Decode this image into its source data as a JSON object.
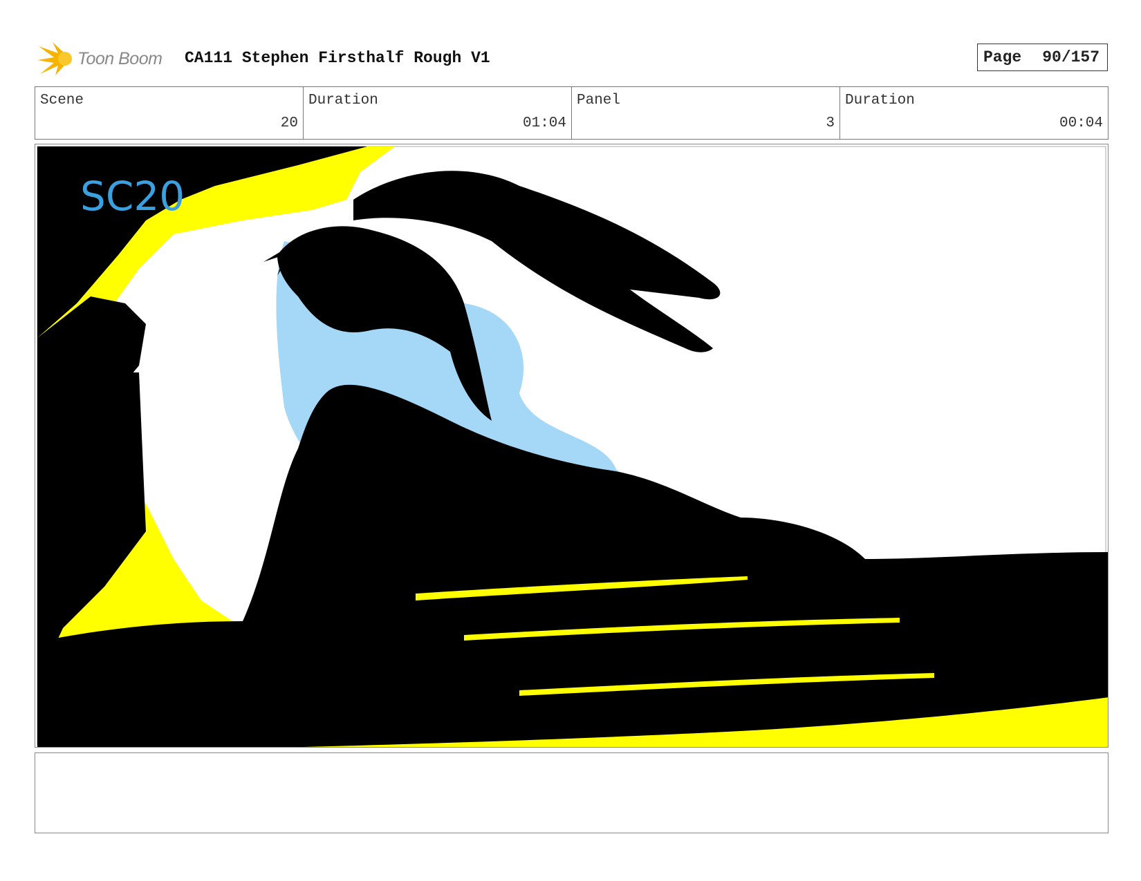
{
  "header": {
    "logo_text": "Toon Boom",
    "title": "CA111 Stephen Firsthalf Rough V1",
    "page_label": "Page",
    "page_number": "90/157"
  },
  "info": {
    "scene_label": "Scene",
    "scene_value": "20",
    "scene_duration_label": "Duration",
    "scene_duration_value": "01:04",
    "panel_label": "Panel",
    "panel_value": "3",
    "panel_duration_label": "Duration",
    "panel_duration_value": "00:04"
  },
  "panel": {
    "sketch_label": "SC20",
    "colors": {
      "black": "#000000",
      "yellow": "#ffff00",
      "blue": "#a5d8f7",
      "label": "#3aa0e0"
    }
  },
  "notes": {
    "text": ""
  }
}
